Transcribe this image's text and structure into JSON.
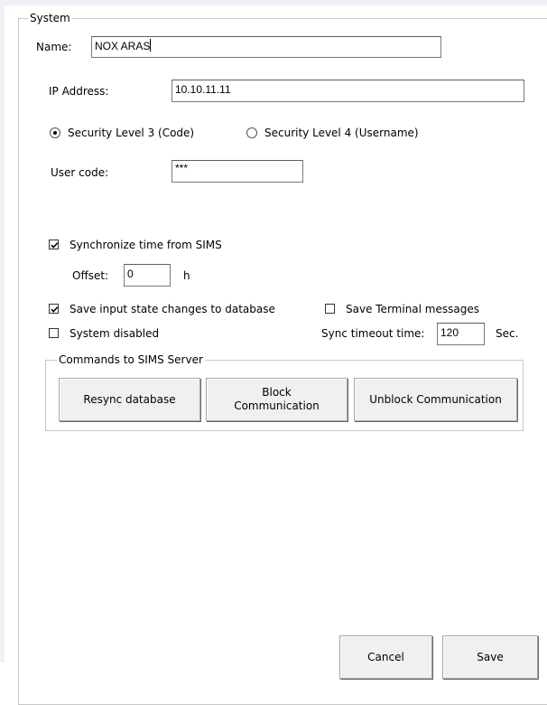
{
  "system": {
    "group_title": "System",
    "name_label": "Name:",
    "name_value": "NOX ARAS",
    "ip_label": "IP Address:",
    "ip_value": "10.10.11.11",
    "security": {
      "level3_label": "Security Level 3 (Code)",
      "level3_selected": true,
      "level4_label": "Security Level 4 (Username)",
      "level4_selected": false
    },
    "user_code_label": "User code:",
    "user_code_value": "***",
    "sync_time_label": "Synchronize time from SIMS",
    "sync_time_checked": true,
    "offset_label": "Offset:",
    "offset_value": "0",
    "offset_unit": "h",
    "save_input_label": "Save input state changes to database",
    "save_input_checked": true,
    "save_terminal_label": "Save Terminal messages",
    "save_terminal_checked": false,
    "system_disabled_label": "System disabled",
    "system_disabled_checked": false,
    "sync_timeout_label": "Sync timeout time:",
    "sync_timeout_value": "120",
    "sync_timeout_unit": "Sec."
  },
  "commands": {
    "group_title": "Commands to SIMS Server",
    "resync_label": "Resync database",
    "block_line1": "Block",
    "block_line2": "Communication",
    "unblock_label": "Unblock Communication"
  },
  "footer": {
    "cancel_label": "Cancel",
    "save_label": "Save"
  }
}
